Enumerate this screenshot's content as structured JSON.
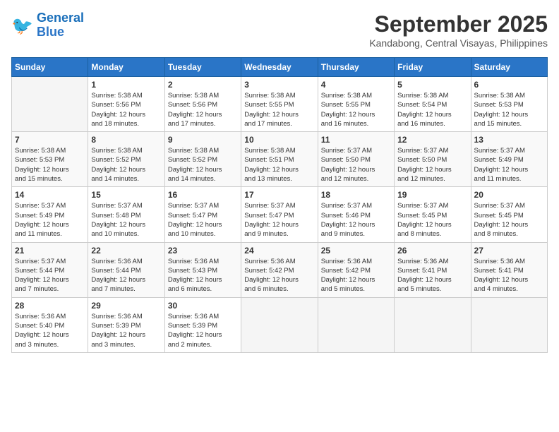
{
  "header": {
    "logo_line1": "General",
    "logo_line2": "Blue",
    "month": "September 2025",
    "location": "Kandabong, Central Visayas, Philippines"
  },
  "days_of_week": [
    "Sunday",
    "Monday",
    "Tuesday",
    "Wednesday",
    "Thursday",
    "Friday",
    "Saturday"
  ],
  "weeks": [
    [
      {
        "day": "",
        "info": ""
      },
      {
        "day": "1",
        "info": "Sunrise: 5:38 AM\nSunset: 5:56 PM\nDaylight: 12 hours\nand 18 minutes."
      },
      {
        "day": "2",
        "info": "Sunrise: 5:38 AM\nSunset: 5:56 PM\nDaylight: 12 hours\nand 17 minutes."
      },
      {
        "day": "3",
        "info": "Sunrise: 5:38 AM\nSunset: 5:55 PM\nDaylight: 12 hours\nand 17 minutes."
      },
      {
        "day": "4",
        "info": "Sunrise: 5:38 AM\nSunset: 5:55 PM\nDaylight: 12 hours\nand 16 minutes."
      },
      {
        "day": "5",
        "info": "Sunrise: 5:38 AM\nSunset: 5:54 PM\nDaylight: 12 hours\nand 16 minutes."
      },
      {
        "day": "6",
        "info": "Sunrise: 5:38 AM\nSunset: 5:53 PM\nDaylight: 12 hours\nand 15 minutes."
      }
    ],
    [
      {
        "day": "7",
        "info": "Sunrise: 5:38 AM\nSunset: 5:53 PM\nDaylight: 12 hours\nand 15 minutes."
      },
      {
        "day": "8",
        "info": "Sunrise: 5:38 AM\nSunset: 5:52 PM\nDaylight: 12 hours\nand 14 minutes."
      },
      {
        "day": "9",
        "info": "Sunrise: 5:38 AM\nSunset: 5:52 PM\nDaylight: 12 hours\nand 14 minutes."
      },
      {
        "day": "10",
        "info": "Sunrise: 5:38 AM\nSunset: 5:51 PM\nDaylight: 12 hours\nand 13 minutes."
      },
      {
        "day": "11",
        "info": "Sunrise: 5:37 AM\nSunset: 5:50 PM\nDaylight: 12 hours\nand 12 minutes."
      },
      {
        "day": "12",
        "info": "Sunrise: 5:37 AM\nSunset: 5:50 PM\nDaylight: 12 hours\nand 12 minutes."
      },
      {
        "day": "13",
        "info": "Sunrise: 5:37 AM\nSunset: 5:49 PM\nDaylight: 12 hours\nand 11 minutes."
      }
    ],
    [
      {
        "day": "14",
        "info": "Sunrise: 5:37 AM\nSunset: 5:49 PM\nDaylight: 12 hours\nand 11 minutes."
      },
      {
        "day": "15",
        "info": "Sunrise: 5:37 AM\nSunset: 5:48 PM\nDaylight: 12 hours\nand 10 minutes."
      },
      {
        "day": "16",
        "info": "Sunrise: 5:37 AM\nSunset: 5:47 PM\nDaylight: 12 hours\nand 10 minutes."
      },
      {
        "day": "17",
        "info": "Sunrise: 5:37 AM\nSunset: 5:47 PM\nDaylight: 12 hours\nand 9 minutes."
      },
      {
        "day": "18",
        "info": "Sunrise: 5:37 AM\nSunset: 5:46 PM\nDaylight: 12 hours\nand 9 minutes."
      },
      {
        "day": "19",
        "info": "Sunrise: 5:37 AM\nSunset: 5:45 PM\nDaylight: 12 hours\nand 8 minutes."
      },
      {
        "day": "20",
        "info": "Sunrise: 5:37 AM\nSunset: 5:45 PM\nDaylight: 12 hours\nand 8 minutes."
      }
    ],
    [
      {
        "day": "21",
        "info": "Sunrise: 5:37 AM\nSunset: 5:44 PM\nDaylight: 12 hours\nand 7 minutes."
      },
      {
        "day": "22",
        "info": "Sunrise: 5:36 AM\nSunset: 5:44 PM\nDaylight: 12 hours\nand 7 minutes."
      },
      {
        "day": "23",
        "info": "Sunrise: 5:36 AM\nSunset: 5:43 PM\nDaylight: 12 hours\nand 6 minutes."
      },
      {
        "day": "24",
        "info": "Sunrise: 5:36 AM\nSunset: 5:42 PM\nDaylight: 12 hours\nand 6 minutes."
      },
      {
        "day": "25",
        "info": "Sunrise: 5:36 AM\nSunset: 5:42 PM\nDaylight: 12 hours\nand 5 minutes."
      },
      {
        "day": "26",
        "info": "Sunrise: 5:36 AM\nSunset: 5:41 PM\nDaylight: 12 hours\nand 5 minutes."
      },
      {
        "day": "27",
        "info": "Sunrise: 5:36 AM\nSunset: 5:41 PM\nDaylight: 12 hours\nand 4 minutes."
      }
    ],
    [
      {
        "day": "28",
        "info": "Sunrise: 5:36 AM\nSunset: 5:40 PM\nDaylight: 12 hours\nand 3 minutes."
      },
      {
        "day": "29",
        "info": "Sunrise: 5:36 AM\nSunset: 5:39 PM\nDaylight: 12 hours\nand 3 minutes."
      },
      {
        "day": "30",
        "info": "Sunrise: 5:36 AM\nSunset: 5:39 PM\nDaylight: 12 hours\nand 2 minutes."
      },
      {
        "day": "",
        "info": ""
      },
      {
        "day": "",
        "info": ""
      },
      {
        "day": "",
        "info": ""
      },
      {
        "day": "",
        "info": ""
      }
    ]
  ]
}
